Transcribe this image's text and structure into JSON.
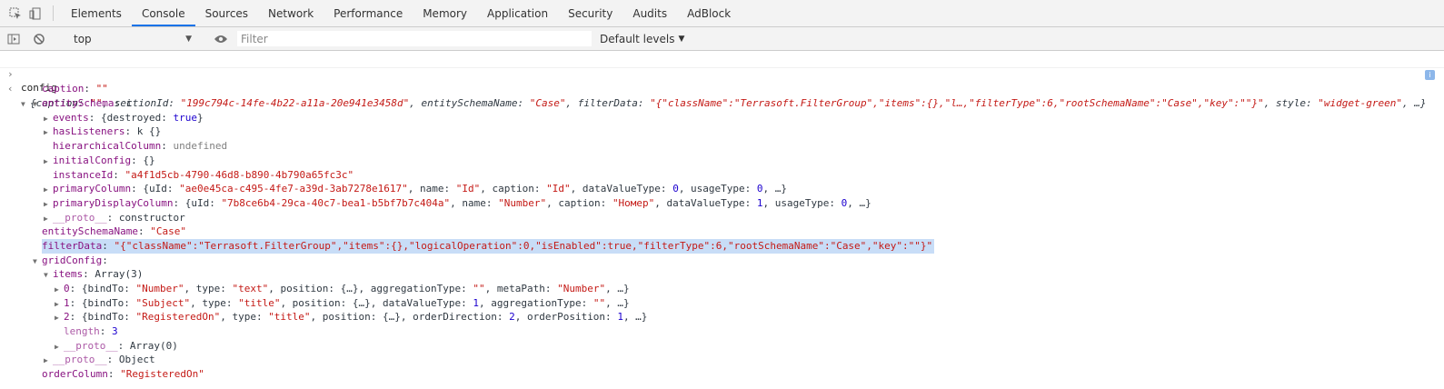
{
  "devtools": {
    "tabs": [
      "Elements",
      "Console",
      "Sources",
      "Network",
      "Performance",
      "Memory",
      "Application",
      "Security",
      "Audits",
      "AdBlock"
    ],
    "active_tab": "Console"
  },
  "toolbar": {
    "context": "top",
    "filter_placeholder": "Filter",
    "levels": "Default levels"
  },
  "console": {
    "input": "config",
    "summary": {
      "pre": "{caption: ",
      "caption": "\"\"",
      "sid_key": ", sectionId: ",
      "sid_val": "\"199c794c-14fe-4b22-a11a-20e941e3458d\"",
      "esn_key": ", entitySchemaName: ",
      "esn_val": "\"Case\"",
      "fd_key": ", filterData: ",
      "fd_val": "\"{\"className\":\"Terrasoft.FilterGroup\",\"items\":{},\"l…,\"filterType\":6,\"rootSchemaName\":\"Case\",\"key\":\"\"}\"",
      "style_key": ", style: ",
      "style_val": "\"widget-green\"",
      "post": ", …}"
    },
    "props": {
      "caption_key": "caption",
      "caption_val": "\"\"",
      "entitySchema_key": "entitySchema",
      "entitySchema_val": "i",
      "events_key": "events",
      "events_val_pre": "{destroyed: ",
      "events_val_bool": "true",
      "events_val_post": "}",
      "hasListeners_key": "hasListeners",
      "hasListeners_val": "k {}",
      "hierarchicalColumn_key": "hierarchicalColumn",
      "hierarchicalColumn_val": "undefined",
      "initialConfig_key": "initialConfig",
      "initialConfig_val": "{}",
      "instanceId_key": "instanceId",
      "instanceId_val": "\"a4f1d5cb-4790-46d8-b890-4b790a65fc3c\"",
      "primaryColumn_key": "primaryColumn",
      "pc_uid": "\"ae0e45ca-c495-4fe7-a39d-3ab7278e1617\"",
      "pc_name": "\"Id\"",
      "pc_caption": "\"Id\"",
      "pc_dvt": "0",
      "pc_ut": "0",
      "primaryDisplayColumn_key": "primaryDisplayColumn",
      "pdc_uid": "\"7b8ce6b4-29ca-40c7-bea1-b5bf7b7c404a\"",
      "pdc_name": "\"Number\"",
      "pdc_caption": "\"Номер\"",
      "pdc_dvt": "1",
      "pdc_ut": "0",
      "proto1_key": "__proto__",
      "proto1_val": "constructor",
      "entitySchemaName_key": "entitySchemaName",
      "entitySchemaName_val": "\"Case\"",
      "filterData_key": "filterData",
      "filterData_val": "\"{\"className\":\"Terrasoft.FilterGroup\",\"items\":{},\"logicalOperation\":0,\"isEnabled\":true,\"filterType\":6,\"rootSchemaName\":\"Case\",\"key\":\"\"}\"",
      "gridConfig_key": "gridConfig",
      "items_key": "items",
      "items_val": "Array(3)",
      "i0_b": "\"Number\"",
      "i0_t": "\"text\"",
      "i0_at": "\"\"",
      "i0_mp": "\"Number\"",
      "i1_b": "\"Subject\"",
      "i1_t": "\"title\"",
      "i1_dvt": "1",
      "i1_at": "\"\"",
      "i2_b": "\"RegisteredOn\"",
      "i2_t": "\"title\"",
      "i2_od": "2",
      "i2_op": "1",
      "length_key": "length",
      "length_val": "3",
      "proto2_val": "Array(0)",
      "proto3_val": "Object",
      "orderColumn_key": "orderColumn",
      "orderColumn_val": "\"RegisteredOn\""
    }
  }
}
